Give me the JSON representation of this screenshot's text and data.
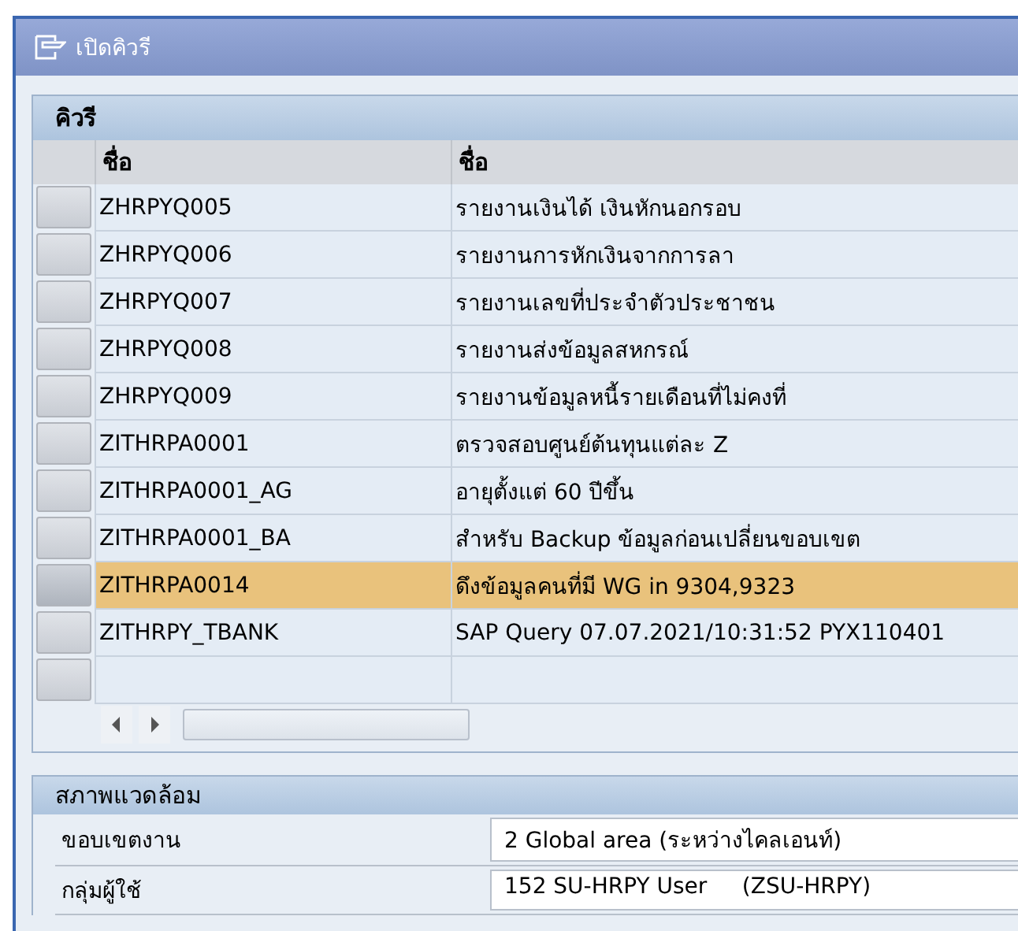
{
  "window": {
    "title": "เปิดคิวรี"
  },
  "queries": {
    "title": "คิวรี",
    "columns": [
      "ชื่อ",
      "ชื่อ"
    ],
    "rows": [
      {
        "name": "ZHRPYQ005",
        "description": "รายงานเงินได้ เงินหักนอกรอบ",
        "selected": false
      },
      {
        "name": "ZHRPYQ006",
        "description": "รายงานการหักเงินจากการลา",
        "selected": false
      },
      {
        "name": "ZHRPYQ007",
        "description": "รายงานเลขที่ประจำตัวประชาชน",
        "selected": false
      },
      {
        "name": "ZHRPYQ008",
        "description": "รายงานส่งข้อมูลสหกรณ์",
        "selected": false
      },
      {
        "name": "ZHRPYQ009",
        "description": "รายงานข้อมูลหนี้รายเดือนที่ไม่คงที่",
        "selected": false
      },
      {
        "name": "ZITHRPA0001",
        "description": "ตรวจสอบศูนย์ต้นทุนแต่ละ Z",
        "selected": false
      },
      {
        "name": "ZITHRPA0001_AG",
        "description": "อายุตั้งแต่ 60  ปีขึ้น",
        "selected": false
      },
      {
        "name": "ZITHRPA0001_BA",
        "description": "สำหรับ Backup ข้อมูลก่อนเปลี่ยนขอบเขต",
        "selected": false
      },
      {
        "name": "ZITHRPA0014",
        "description": "ดึงข้อมูลคนที่มี WG in 9304,9323",
        "selected": true
      },
      {
        "name": "ZITHRPY_TBANK",
        "description": "SAP Query 07.07.2021/10:31:52 PYX110401",
        "selected": false
      }
    ]
  },
  "environment": {
    "title": "สภาพแวดล้อม",
    "fields": [
      {
        "label": "ขอบเขตงาน",
        "value": "2 Global area (ระหว่างไคลเอนท์)"
      },
      {
        "label": "กลุ่มผู้ใช้",
        "value": "152 SU-HRPY User     (ZSU-HRPY)"
      }
    ]
  }
}
